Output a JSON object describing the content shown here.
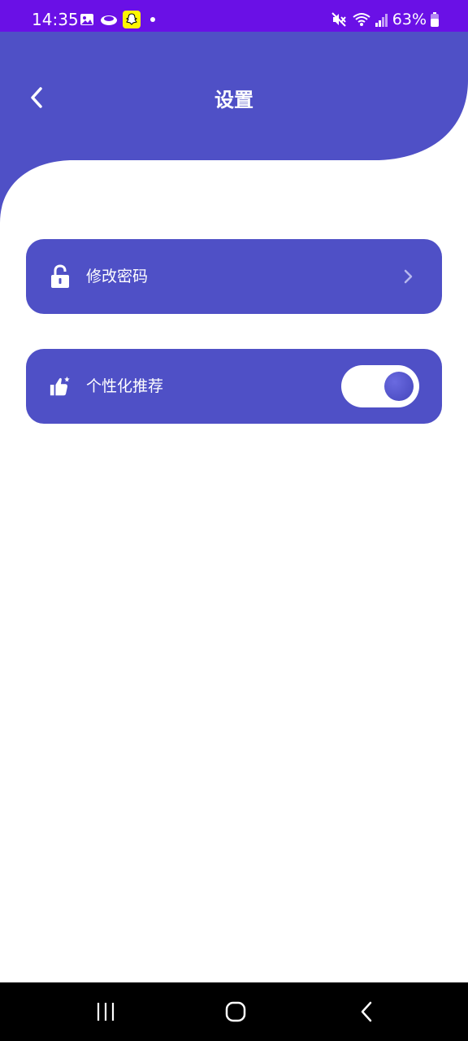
{
  "status_bar": {
    "time": "14:35",
    "battery": "63%",
    "icons": [
      "gallery-icon",
      "cloud-icon",
      "snapchat-icon",
      "dot-icon",
      "mute-icon",
      "wifi-icon",
      "signal-icon",
      "battery-icon"
    ]
  },
  "header": {
    "title": "设置",
    "back_icon": "chevron-left-icon"
  },
  "settings": {
    "items": [
      {
        "label": "修改密码",
        "icon": "lock-icon",
        "control": "chevron-right-icon"
      },
      {
        "label": "个性化推荐",
        "icon": "thumbs-up-icon",
        "control": "toggle",
        "toggle_on": true
      }
    ]
  },
  "nav_bar": {
    "buttons": [
      "recents-icon",
      "home-icon",
      "back-icon"
    ]
  },
  "colors": {
    "status_bar": "#6a10e6",
    "brand": "#4f50c6",
    "background": "#ffffff",
    "nav_bar": "#000000"
  }
}
